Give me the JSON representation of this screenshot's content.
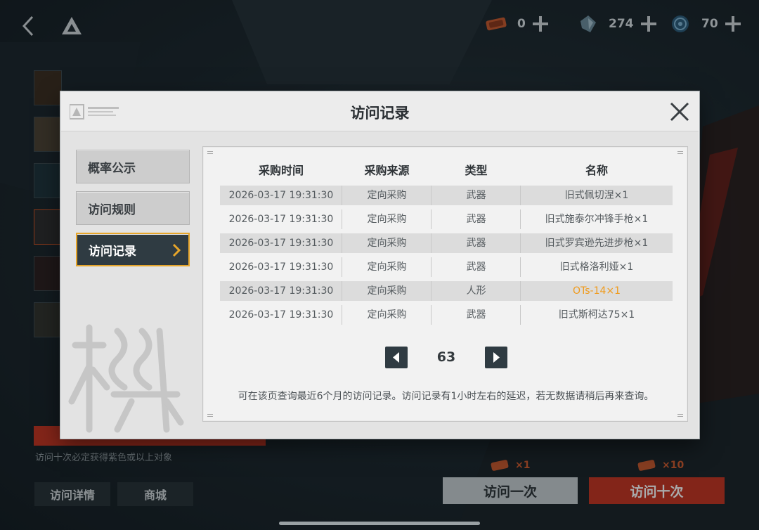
{
  "currencies": [
    {
      "icon": "ticket-icon",
      "amount": "0"
    },
    {
      "icon": "crystal-icon",
      "amount": "274"
    },
    {
      "icon": "coin-icon",
      "amount": "70"
    }
  ],
  "pool": {
    "hint": "访问十次必定获得紫色或以上对象"
  },
  "bottom": {
    "detail_label": "访问详情",
    "shop_label": "商城",
    "draw_once_label": "访问一次",
    "draw_ten_label": "访问十次",
    "cost_once": "×1",
    "cost_ten": "×10"
  },
  "modal": {
    "title": "访问记录",
    "nav": [
      {
        "label": "概率公示",
        "active": false
      },
      {
        "label": "访问规则",
        "active": false
      },
      {
        "label": "访问记录",
        "active": true
      }
    ],
    "table": {
      "headers": [
        "采购时间",
        "采购来源",
        "类型",
        "名称"
      ],
      "rows": [
        {
          "time": "2026-03-17 19:31:30",
          "source": "定向采购",
          "type": "武器",
          "name": "旧式佩切涅×1",
          "highlight": false
        },
        {
          "time": "2026-03-17 19:31:30",
          "source": "定向采购",
          "type": "武器",
          "name": "旧式施泰尔冲锋手枪×1",
          "highlight": false
        },
        {
          "time": "2026-03-17 19:31:30",
          "source": "定向采购",
          "type": "武器",
          "name": "旧式罗宾逊先进步枪×1",
          "highlight": false
        },
        {
          "time": "2026-03-17 19:31:30",
          "source": "定向采购",
          "type": "武器",
          "name": "旧式格洛利娅×1",
          "highlight": false
        },
        {
          "time": "2026-03-17 19:31:30",
          "source": "定向采购",
          "type": "人形",
          "name": "OTs-14×1",
          "highlight": true
        },
        {
          "time": "2026-03-17 19:31:30",
          "source": "定向采购",
          "type": "武器",
          "name": "旧式斯柯达75×1",
          "highlight": false
        }
      ]
    },
    "page": "63",
    "note": "可在该页查询最近6个月的访问记录。访问记录有1小时左右的延迟，若无数据请稍后再来查询。"
  },
  "colors": {
    "accent_orange": "#f09a1a",
    "active_border": "#e6a52a",
    "dark_button": "#2f3b42",
    "draw_red": "#c5321e"
  }
}
